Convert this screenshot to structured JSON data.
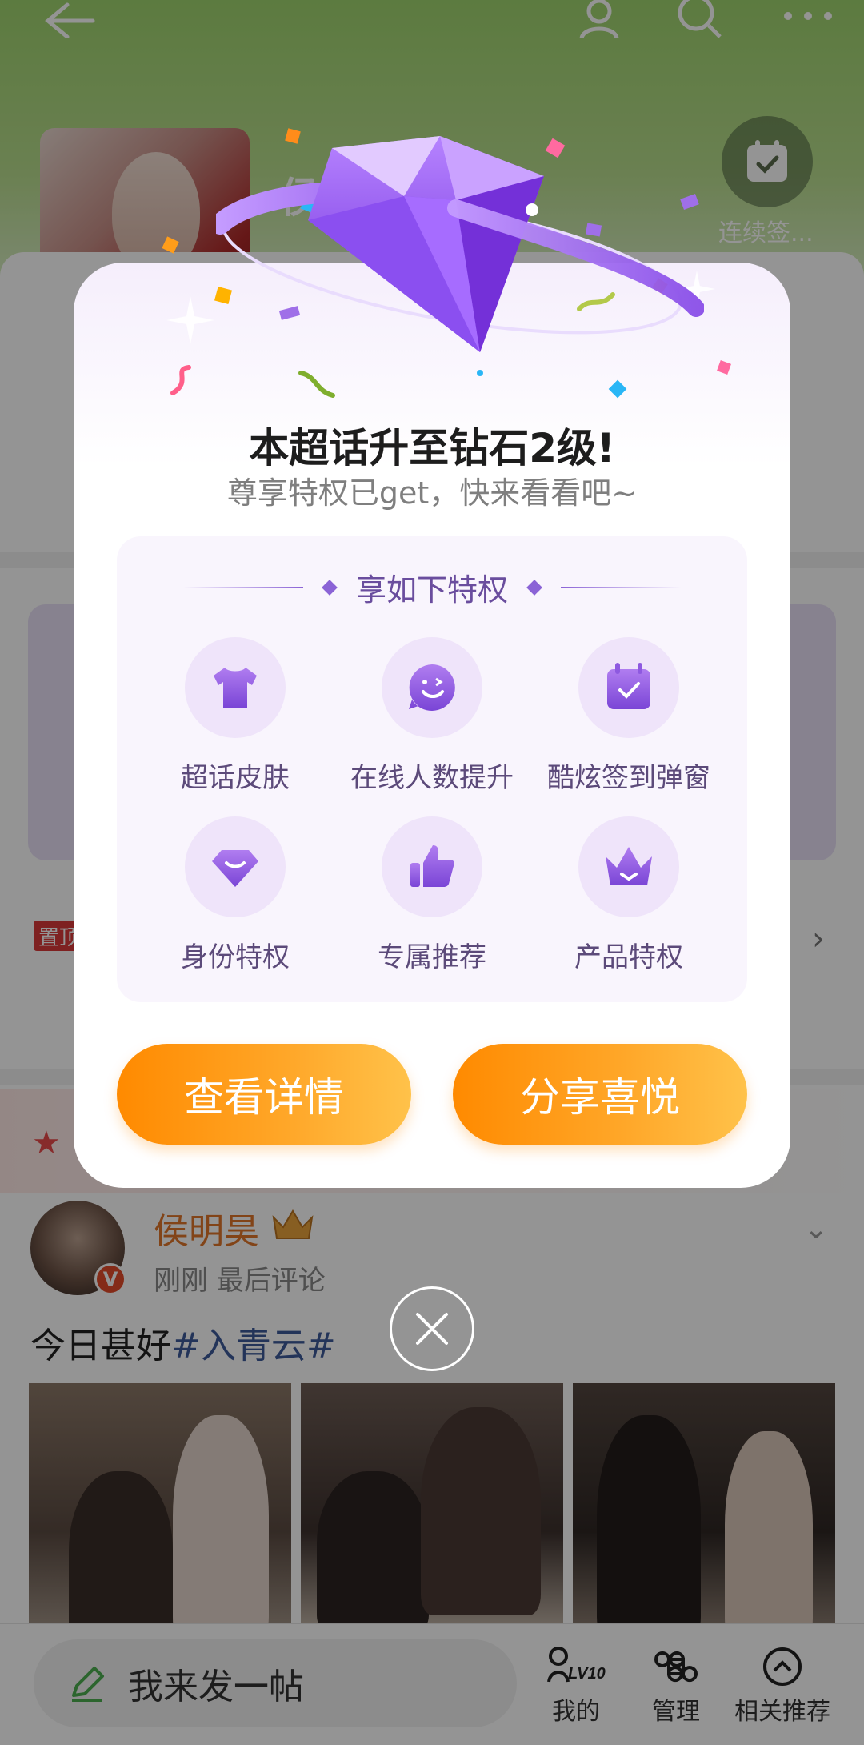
{
  "topic": {
    "title": "侯明昊",
    "checkin_label": "连续签..."
  },
  "post": {
    "author": "侯明昊",
    "meta": "刚刚 最后评论",
    "text": "今日甚好",
    "tag": "#入青云#",
    "verified_badge": "V"
  },
  "pin_label": "置顶",
  "bottom_bar": {
    "input_label": "我来发一帖",
    "tabs": [
      {
        "label": "我的",
        "icon": "level-icon",
        "badge": "LV10"
      },
      {
        "label": "管理",
        "icon": "command-icon"
      },
      {
        "label": "相关推荐",
        "icon": "chevron-up-circle-icon"
      }
    ]
  },
  "dialog": {
    "title": "本超话升至钻石2级!",
    "subtitle": "尊享特权已get，快来看看吧~",
    "privileges_heading": "享如下特权",
    "privileges": [
      {
        "label": "超话皮肤",
        "icon": "tshirt-icon"
      },
      {
        "label": "在线人数提升",
        "icon": "smiley-icon"
      },
      {
        "label": "酷炫签到弹窗",
        "icon": "calendar-check-icon"
      },
      {
        "label": "身份特权",
        "icon": "diamond-icon"
      },
      {
        "label": "专属推荐",
        "icon": "thumbs-up-icon"
      },
      {
        "label": "产品特权",
        "icon": "crown-icon"
      }
    ],
    "details_button": "查看详情",
    "share_button": "分享喜悦"
  },
  "colors": {
    "accent_orange": "#ff8a00",
    "privilege_purple": "#8b63d6",
    "header_green": "#9fd46e"
  }
}
